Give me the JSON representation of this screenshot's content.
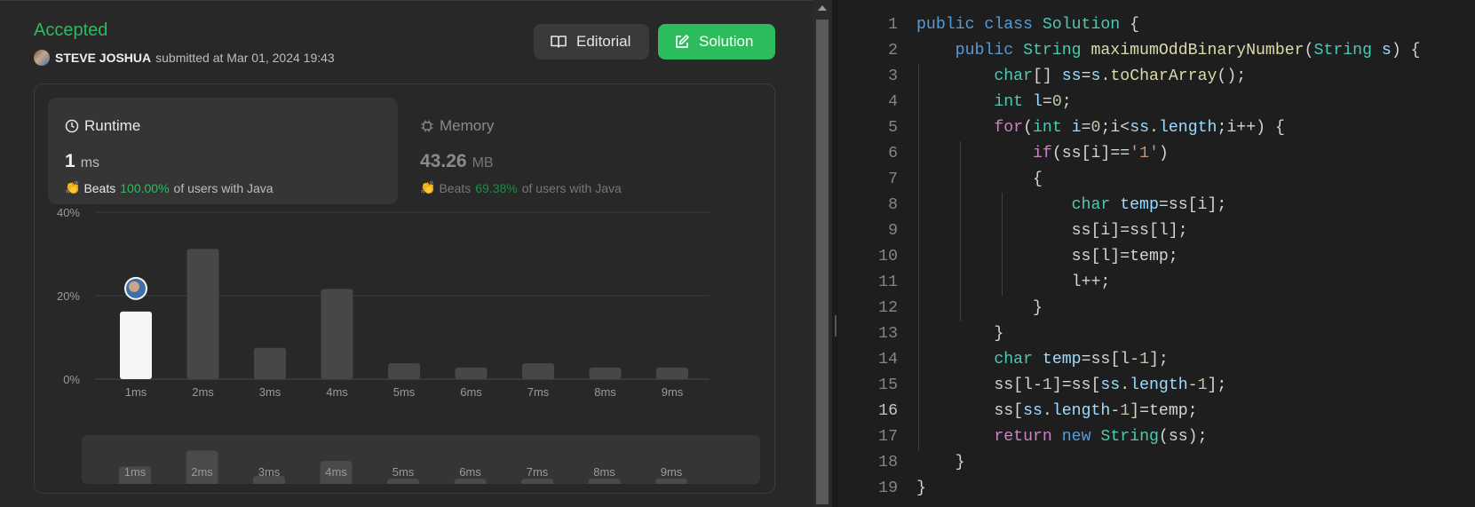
{
  "submission": {
    "status": "Accepted",
    "author": "STEVE JOSHUA",
    "submitted_text": "submitted at Mar 01, 2024 19:43",
    "editorial_label": "Editorial",
    "solution_label": "Solution"
  },
  "runtime": {
    "label": "Runtime",
    "value": "1",
    "unit": "ms",
    "beats_prefix": "Beats",
    "beats_pct": "100.00%",
    "beats_suffix": "of users with Java"
  },
  "memory": {
    "label": "Memory",
    "value": "43.26",
    "unit": "MB",
    "beats_prefix": "Beats",
    "beats_pct": "69.38%",
    "beats_suffix": "of users with Java"
  },
  "colors": {
    "accent_green": "#2cbb5d",
    "selected_bar": "#f5f5f5",
    "bar": "#474747"
  },
  "chart_data": {
    "type": "bar",
    "categories": [
      "1ms",
      "2ms",
      "3ms",
      "4ms",
      "5ms",
      "6ms",
      "7ms",
      "8ms",
      "9ms"
    ],
    "values": [
      16.2,
      31.2,
      7.5,
      21.6,
      3.8,
      2.8,
      3.8,
      2.8,
      2.8
    ],
    "yticks": [
      "40%",
      "20%",
      "0%"
    ],
    "ylim": [
      0,
      40
    ],
    "selected_category": "1ms",
    "grid": true
  },
  "editor": {
    "active_line": 16,
    "lines": [
      [
        [
          "public class ",
          "#569cd6"
        ],
        [
          "Solution",
          "#4ec9b0"
        ],
        [
          " {",
          "#d4d4d4"
        ]
      ],
      [
        [
          "    public ",
          "#569cd6"
        ],
        [
          "String ",
          "#4ec9b0"
        ],
        [
          "maximumOddBinaryNumber",
          "#dcdcaa"
        ],
        [
          "(",
          "#d4d4d4"
        ],
        [
          "String ",
          "#4ec9b0"
        ],
        [
          "s",
          "#9cdcfe"
        ],
        [
          ") {",
          "#d4d4d4"
        ]
      ],
      [
        [
          "        ",
          "#d4d4d4"
        ],
        [
          "char",
          "#4ec9b0"
        ],
        [
          "[] ",
          "#d4d4d4"
        ],
        [
          "ss",
          "#9cdcfe"
        ],
        [
          "=",
          "#d4d4d4"
        ],
        [
          "s",
          "#9cdcfe"
        ],
        [
          ".",
          "#d4d4d4"
        ],
        [
          "toCharArray",
          "#dcdcaa"
        ],
        [
          "();",
          "#d4d4d4"
        ]
      ],
      [
        [
          "        ",
          "#d4d4d4"
        ],
        [
          "int ",
          "#4ec9b0"
        ],
        [
          "l",
          "#9cdcfe"
        ],
        [
          "=",
          "#d4d4d4"
        ],
        [
          "0",
          "#b5cea8"
        ],
        [
          ";",
          "#d4d4d4"
        ]
      ],
      [
        [
          "        ",
          "#d4d4d4"
        ],
        [
          "for",
          "#c586c0"
        ],
        [
          "(",
          "#d4d4d4"
        ],
        [
          "int ",
          "#4ec9b0"
        ],
        [
          "i",
          "#9cdcfe"
        ],
        [
          "=",
          "#d4d4d4"
        ],
        [
          "0",
          "#b5cea8"
        ],
        [
          ";i<",
          "#d4d4d4"
        ],
        [
          "ss",
          "#9cdcfe"
        ],
        [
          ".",
          "#d4d4d4"
        ],
        [
          "length",
          "#9cdcfe"
        ],
        [
          ";i++) {",
          "#d4d4d4"
        ]
      ],
      [
        [
          "            ",
          "#d4d4d4"
        ],
        [
          "if",
          "#c586c0"
        ],
        [
          "(ss[i]==",
          "#d4d4d4"
        ],
        [
          "'1'",
          "#ce9178"
        ],
        [
          ")",
          "#d4d4d4"
        ]
      ],
      [
        [
          "            {",
          "#d4d4d4"
        ]
      ],
      [
        [
          "                ",
          "#d4d4d4"
        ],
        [
          "char ",
          "#4ec9b0"
        ],
        [
          "temp",
          "#9cdcfe"
        ],
        [
          "=ss[i];",
          "#d4d4d4"
        ]
      ],
      [
        [
          "                ss[i]=ss[l];",
          "#d4d4d4"
        ]
      ],
      [
        [
          "                ss[l]=temp;",
          "#d4d4d4"
        ]
      ],
      [
        [
          "                l++;",
          "#d4d4d4"
        ]
      ],
      [
        [
          "            }",
          "#d4d4d4"
        ]
      ],
      [
        [
          "        }",
          "#d4d4d4"
        ]
      ],
      [
        [
          "        ",
          "#d4d4d4"
        ],
        [
          "char ",
          "#4ec9b0"
        ],
        [
          "temp",
          "#9cdcfe"
        ],
        [
          "=ss[l-",
          "#d4d4d4"
        ],
        [
          "1",
          "#b5cea8"
        ],
        [
          "];",
          "#d4d4d4"
        ]
      ],
      [
        [
          "        ss[l-",
          "#d4d4d4"
        ],
        [
          "1",
          "#b5cea8"
        ],
        [
          "]=ss[",
          "#d4d4d4"
        ],
        [
          "ss",
          "#9cdcfe"
        ],
        [
          ".",
          "#d4d4d4"
        ],
        [
          "length",
          "#9cdcfe"
        ],
        [
          "-",
          "#d4d4d4"
        ],
        [
          "1",
          "#b5cea8"
        ],
        [
          "];",
          "#d4d4d4"
        ]
      ],
      [
        [
          "        ss[",
          "#d4d4d4"
        ],
        [
          "ss",
          "#9cdcfe"
        ],
        [
          ".",
          "#d4d4d4"
        ],
        [
          "length",
          "#9cdcfe"
        ],
        [
          "-",
          "#d4d4d4"
        ],
        [
          "1",
          "#b5cea8"
        ],
        [
          "]=temp;",
          "#d4d4d4"
        ]
      ],
      [
        [
          "        ",
          "#d4d4d4"
        ],
        [
          "return ",
          "#c586c0"
        ],
        [
          "new ",
          "#569cd6"
        ],
        [
          "String",
          "#4ec9b0"
        ],
        [
          "(ss);",
          "#d4d4d4"
        ]
      ],
      [
        [
          "    }",
          "#d4d4d4"
        ]
      ],
      [
        [
          "}",
          "#d4d4d4"
        ]
      ]
    ]
  }
}
